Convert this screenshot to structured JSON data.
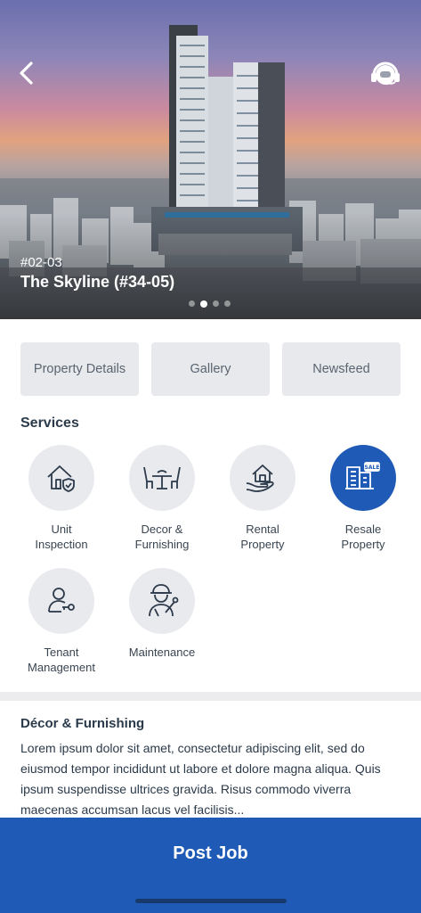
{
  "hero": {
    "unit_number": "#02-03",
    "property_name": "The Skyline (#34-05)",
    "carousel": {
      "count": 4,
      "active_index": 1
    }
  },
  "tabs": [
    {
      "label": "Property Details"
    },
    {
      "label": "Gallery"
    },
    {
      "label": "Newsfeed"
    }
  ],
  "services": {
    "title": "Services",
    "items": [
      {
        "label": "Unit\nInspection",
        "icon": "house-shield-icon",
        "active": false
      },
      {
        "label": "Decor &\nFurnishing",
        "icon": "dining-set-icon",
        "active": false
      },
      {
        "label": "Rental\nProperty",
        "icon": "hand-house-icon",
        "active": false
      },
      {
        "label": "Resale\nProperty",
        "icon": "building-sale-icon",
        "active": true
      },
      {
        "label": "Tenant\nManagement",
        "icon": "person-key-icon",
        "active": false
      },
      {
        "label": "Maintenance",
        "icon": "worker-tools-icon",
        "active": false
      }
    ]
  },
  "description": {
    "title": "Décor & Furnishing",
    "body": "Lorem ipsum dolor sit amet, consectetur adipiscing elit, sed do eiusmod tempor incididunt ut labore et dolore magna aliqua. Quis ipsum suspendisse ultrices gravida. Risus commodo viverra maecenas accumsan lacus vel facilisis..."
  },
  "footer": {
    "post_job_label": "Post Job"
  },
  "colors": {
    "accent": "#1f5bb6",
    "tab_bg": "#e8e9ec",
    "icon_circle": "#e9eaee",
    "text": "#2b3a4a"
  },
  "icons": {
    "back": "chevron-left-icon",
    "support": "support-agent-icon"
  }
}
